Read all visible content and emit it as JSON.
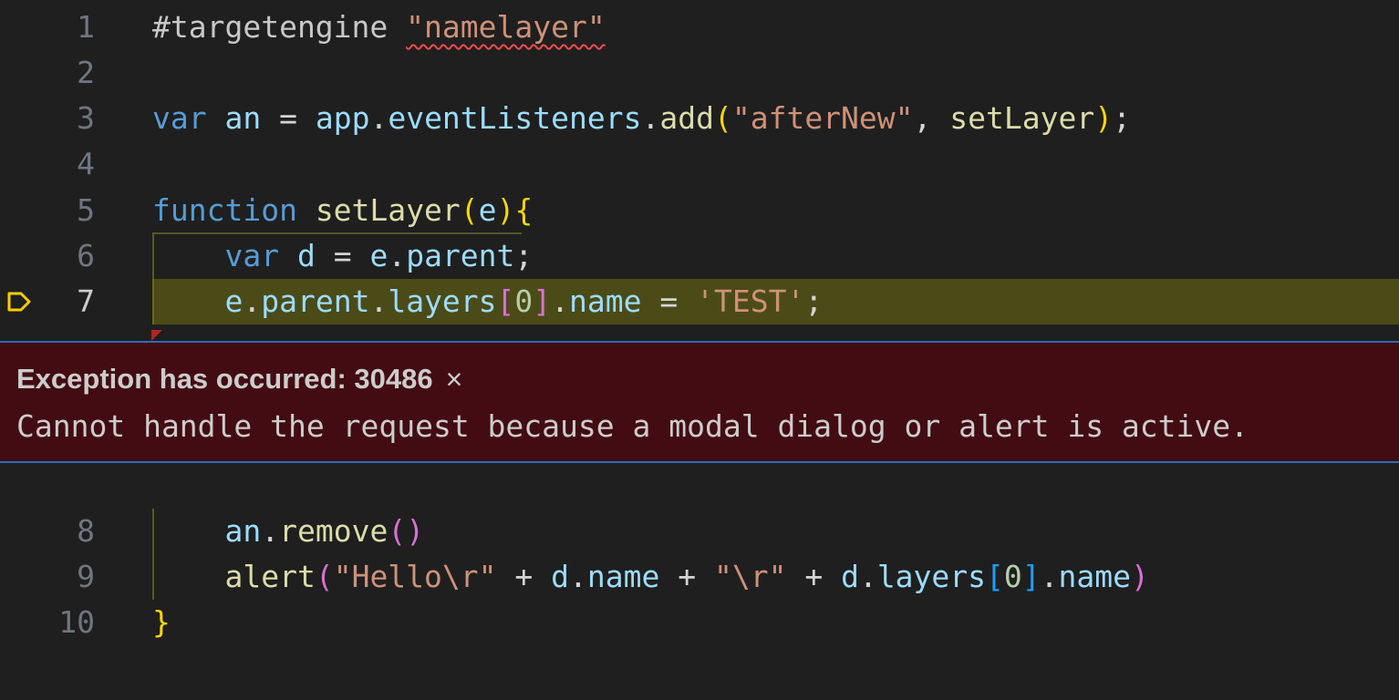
{
  "editor": {
    "lines": [
      {
        "n": "1",
        "tokens": [
          {
            "t": "#targetengine ",
            "c": "pre"
          },
          {
            "t": "\"namelayer\"",
            "c": "str squiggle"
          }
        ]
      },
      {
        "n": "2",
        "tokens": []
      },
      {
        "n": "3",
        "tokens": [
          {
            "t": "var ",
            "c": "kw"
          },
          {
            "t": "an",
            "c": "var"
          },
          {
            "t": " = ",
            "c": "op"
          },
          {
            "t": "app",
            "c": "var"
          },
          {
            "t": ".",
            "c": "op"
          },
          {
            "t": "eventListeners",
            "c": "var"
          },
          {
            "t": ".",
            "c": "op"
          },
          {
            "t": "add",
            "c": "fn"
          },
          {
            "t": "(",
            "c": "p1"
          },
          {
            "t": "\"afterNew\"",
            "c": "str"
          },
          {
            "t": ", ",
            "c": "op"
          },
          {
            "t": "setLayer",
            "c": "fn"
          },
          {
            "t": ")",
            "c": "p1"
          },
          {
            "t": ";",
            "c": "op"
          }
        ]
      },
      {
        "n": "4",
        "tokens": []
      },
      {
        "n": "5",
        "tokens": [
          {
            "t": "function ",
            "c": "kw"
          },
          {
            "t": "setLayer",
            "c": "fn"
          },
          {
            "t": "(",
            "c": "p1"
          },
          {
            "t": "e",
            "c": "var"
          },
          {
            "t": ")",
            "c": "p1"
          },
          {
            "t": "{",
            "c": "p1"
          }
        ]
      },
      {
        "n": "6",
        "tokens": [
          {
            "t": "    ",
            "c": "op"
          },
          {
            "t": "var ",
            "c": "kw"
          },
          {
            "t": "d",
            "c": "var"
          },
          {
            "t": " = ",
            "c": "op"
          },
          {
            "t": "e",
            "c": "var"
          },
          {
            "t": ".",
            "c": "op"
          },
          {
            "t": "parent",
            "c": "var"
          },
          {
            "t": ";",
            "c": "op"
          }
        ]
      },
      {
        "n": "7",
        "tokens": [
          {
            "t": "    ",
            "c": "op"
          },
          {
            "t": "e",
            "c": "var"
          },
          {
            "t": ".",
            "c": "op"
          },
          {
            "t": "parent",
            "c": "var"
          },
          {
            "t": ".",
            "c": "op"
          },
          {
            "t": "layers",
            "c": "var"
          },
          {
            "t": "[",
            "c": "p2"
          },
          {
            "t": "0",
            "c": "num"
          },
          {
            "t": "]",
            "c": "p2"
          },
          {
            "t": ".",
            "c": "op"
          },
          {
            "t": "name",
            "c": "var"
          },
          {
            "t": " = ",
            "c": "op"
          },
          {
            "t": "'TEST'",
            "c": "str"
          },
          {
            "t": ";",
            "c": "op"
          }
        ]
      },
      {
        "n": "8",
        "tokens": [
          {
            "t": "    ",
            "c": "op"
          },
          {
            "t": "an",
            "c": "var"
          },
          {
            "t": ".",
            "c": "op"
          },
          {
            "t": "remove",
            "c": "fn"
          },
          {
            "t": "(",
            "c": "p2"
          },
          {
            "t": ")",
            "c": "p2"
          }
        ]
      },
      {
        "n": "9",
        "tokens": [
          {
            "t": "    ",
            "c": "op"
          },
          {
            "t": "alert",
            "c": "fn"
          },
          {
            "t": "(",
            "c": "p2"
          },
          {
            "t": "\"Hello\\r\"",
            "c": "str"
          },
          {
            "t": " + ",
            "c": "op"
          },
          {
            "t": "d",
            "c": "var"
          },
          {
            "t": ".",
            "c": "op"
          },
          {
            "t": "name",
            "c": "var"
          },
          {
            "t": " + ",
            "c": "op"
          },
          {
            "t": "\"\\r\"",
            "c": "str"
          },
          {
            "t": " + ",
            "c": "op"
          },
          {
            "t": "d",
            "c": "var"
          },
          {
            "t": ".",
            "c": "op"
          },
          {
            "t": "layers",
            "c": "var"
          },
          {
            "t": "[",
            "c": "p3"
          },
          {
            "t": "0",
            "c": "num"
          },
          {
            "t": "]",
            "c": "p3"
          },
          {
            "t": ".",
            "c": "op"
          },
          {
            "t": "name",
            "c": "var"
          },
          {
            "t": ")",
            "c": "p2"
          }
        ]
      },
      {
        "n": "10",
        "tokens": [
          {
            "t": "}",
            "c": "p1"
          }
        ]
      }
    ],
    "active_line": "7",
    "stack_frame_icon": "debug-stackframe-icon"
  },
  "exception": {
    "title": "Exception has occurred: 30486",
    "close_icon": "×",
    "message": "Cannot handle the request because a modal dialog or alert is active."
  },
  "colors": {
    "background": "#1f1f1f",
    "current_line": "#4b4b18",
    "exception_background": "#420c12",
    "exception_border": "#2b6cb8"
  }
}
